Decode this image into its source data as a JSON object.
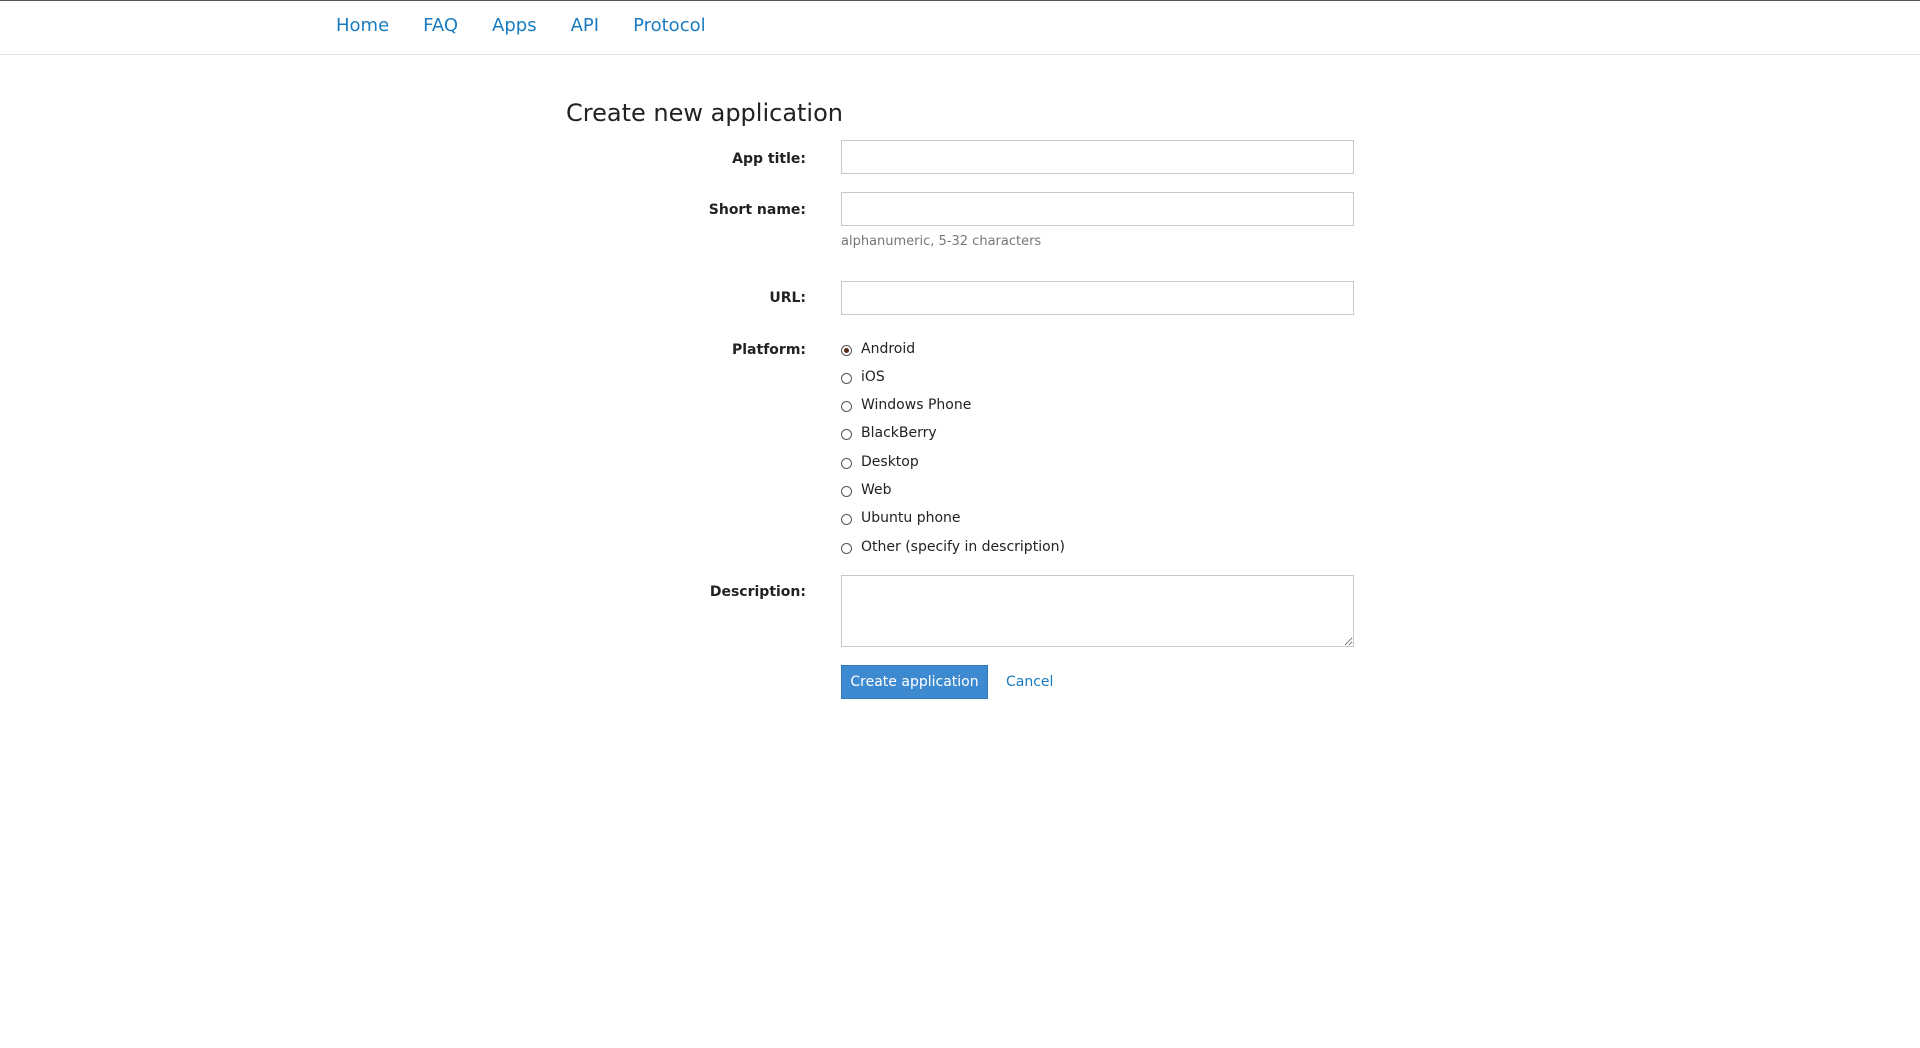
{
  "nav": {
    "items": [
      {
        "label": "Home"
      },
      {
        "label": "FAQ"
      },
      {
        "label": "Apps"
      },
      {
        "label": "API"
      },
      {
        "label": "Protocol"
      }
    ]
  },
  "page": {
    "title": "Create new application"
  },
  "form": {
    "app_title": {
      "label": "App title:",
      "value": ""
    },
    "short_name": {
      "label": "Short name:",
      "value": "",
      "hint": "alphanumeric, 5-32 characters"
    },
    "url": {
      "label": "URL:",
      "value": ""
    },
    "platform": {
      "label": "Platform:",
      "selected": "Android",
      "options": [
        {
          "label": "Android",
          "checked": true
        },
        {
          "label": "iOS",
          "checked": false
        },
        {
          "label": "Windows Phone",
          "checked": false
        },
        {
          "label": "BlackBerry",
          "checked": false
        },
        {
          "label": "Desktop",
          "checked": false
        },
        {
          "label": "Web",
          "checked": false
        },
        {
          "label": "Ubuntu phone",
          "checked": false
        },
        {
          "label": "Other (specify in description)",
          "checked": false
        }
      ]
    },
    "description": {
      "label": "Description:",
      "value": ""
    },
    "submit_label": "Create application",
    "cancel_label": "Cancel"
  },
  "colors": {
    "link": "#1a7bbf",
    "primary_button": "#3d8ad0"
  }
}
